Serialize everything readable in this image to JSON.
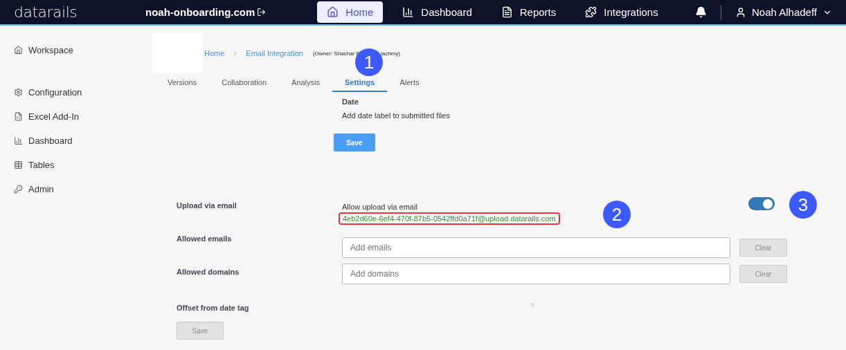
{
  "topbar": {
    "logo": "datarails",
    "workspace": "noah-onboarding.com",
    "nav": [
      {
        "label": "Home",
        "selected": true
      },
      {
        "label": "Dashboard",
        "selected": false
      },
      {
        "label": "Reports",
        "selected": false
      },
      {
        "label": "Integrations",
        "selected": false
      }
    ],
    "user": "Noah Alhadeff"
  },
  "sidebar": {
    "groups": [
      [
        "Workspace"
      ],
      [
        "Configuration",
        "Excel Add-In",
        "Dashboard",
        "Tables",
        "Admin"
      ]
    ]
  },
  "breadcrumb": {
    "items": [
      "Home",
      "Email Integration"
    ],
    "owner": [
      "(Owner: Shachar B",
      "lachmy)"
    ]
  },
  "tabs": [
    {
      "label": "Versions",
      "selected": false
    },
    {
      "label": "Collaboration",
      "selected": false
    },
    {
      "label": "Analysis",
      "selected": false
    },
    {
      "label": "Settings",
      "selected": true
    },
    {
      "label": "Alerts",
      "selected": false
    }
  ],
  "date_section": {
    "title": "Date",
    "description": "Add date label to submitted files",
    "button": {
      "label": "Save",
      "disabled": false
    }
  },
  "upload": {
    "label": "Upload via email",
    "caption": "Allow upload via email",
    "address": "4eb2d60e-6ef4-470f-87b5-0542ffd0a71f@upload.datarails.com",
    "on": true
  },
  "fields": [
    {
      "label": "Allowed emails",
      "placeholder": "Add emails",
      "button": "Clear"
    },
    {
      "label": "Allowed domains",
      "placeholder": "Add domains",
      "button": "Clear"
    }
  ],
  "offset": {
    "label": "Offset from date tag",
    "value": "0"
  },
  "save_button": {
    "label": "Save",
    "disabled": true
  },
  "markers": [
    "1",
    "2",
    "3"
  ]
}
